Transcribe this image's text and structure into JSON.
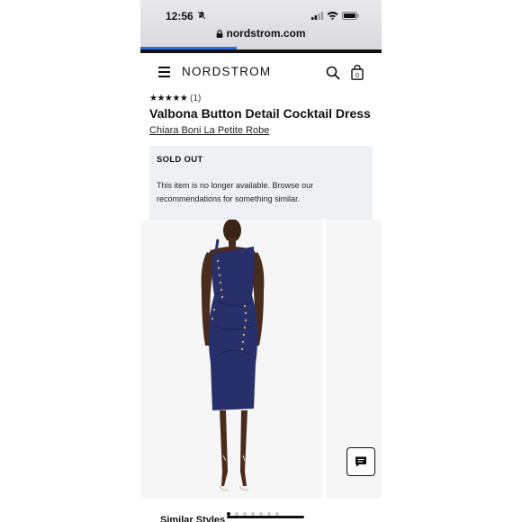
{
  "status_bar": {
    "time": "12:56"
  },
  "browser": {
    "url": "nordstrom.com",
    "load_progress": 0.4
  },
  "header": {
    "logo": "NORDSTROM"
  },
  "product": {
    "stars": "★★★★★",
    "review_count": "(1)",
    "title": "Valbona Button Detail Cocktail Dress",
    "brand": "Chiara Boni La Petite Robe"
  },
  "availability": {
    "status": "SOLD OUT",
    "message": "This item is no longer available. Browse our recommendations for something similar."
  },
  "carousel": {
    "slide_count": 7,
    "active_index": 0
  },
  "section": {
    "similar_styles": "Similar Styles"
  },
  "colors": {
    "dress": "#27306a",
    "sold_out_bg": "#eef1f4",
    "accent": "#2f6ee0"
  },
  "icons": [
    "bell-slash-icon",
    "signal-icon",
    "wifi-icon",
    "battery-icon",
    "lock-icon",
    "menu-icon",
    "search-icon",
    "shopping-bag-icon",
    "chat-icon"
  ]
}
